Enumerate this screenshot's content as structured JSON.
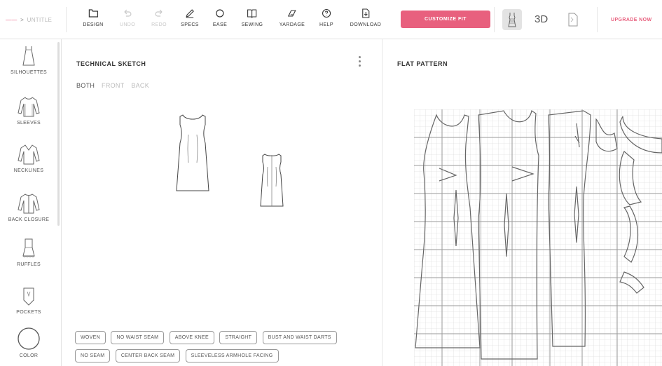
{
  "breadcrumb": {
    "brand": "——",
    "separator": ">",
    "item": "UNTITLE"
  },
  "toolbar": {
    "design": "DESIGN",
    "undo": "UNDO",
    "redo": "REDO",
    "specs": "SPECS",
    "ease": "EASE",
    "sewing": "SEWING",
    "yardage": "YARDAGE",
    "help": "HELP",
    "download": "DOWNLOAD"
  },
  "customize": "CUSTOMIZE FIT",
  "view3d": "3D",
  "upgrade": "UPGRADE NOW",
  "sidebar": [
    {
      "label": "SILHOUETTES"
    },
    {
      "label": "SLEEVES"
    },
    {
      "label": "NECKLINES"
    },
    {
      "label": "BACK CLOSURE"
    },
    {
      "label": "RUFFLES"
    },
    {
      "label": "POCKETS"
    },
    {
      "label": "COLOR"
    }
  ],
  "sketch": {
    "title": "TECHNICAL SKETCH",
    "views": [
      "BOTH",
      "FRONT",
      "BACK"
    ],
    "active_view": "BOTH"
  },
  "tags": [
    "WOVEN",
    "NO WAIST SEAM",
    "ABOVE KNEE",
    "STRAIGHT",
    "BUST AND WAIST DARTS",
    "NO SEAM",
    "CENTER BACK SEAM",
    "SLEEVELESS ARMHOLE FACING"
  ],
  "pattern": {
    "title": "FLAT PATTERN"
  },
  "colors": {
    "accent": "#e8607e",
    "grid": "#cfcfcf"
  }
}
